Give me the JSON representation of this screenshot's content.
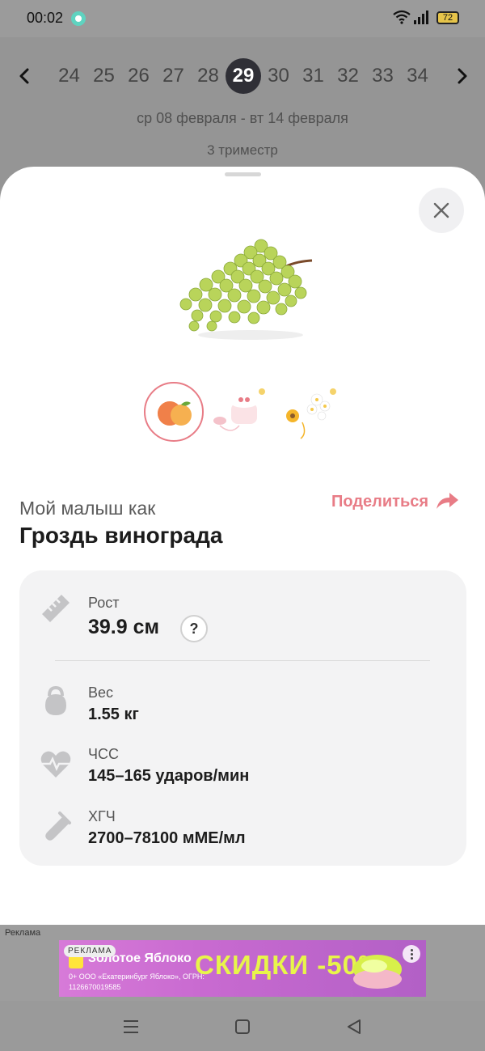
{
  "status_bar": {
    "time": "00:02",
    "battery": "72"
  },
  "week_nav": {
    "weeks": [
      "24",
      "25",
      "26",
      "27",
      "28",
      "29",
      "30",
      "31",
      "32",
      "33",
      "34"
    ],
    "selected": "29",
    "date_range": "ср 08 февраля - вт 14 февраля",
    "trimester": "3 триместр"
  },
  "size_compare": {
    "subtitle": "Мой малыш как",
    "title": "Гроздь винограда",
    "share_label": "Поделиться",
    "thumbnails": [
      "peach",
      "cake",
      "flowers"
    ],
    "selected_thumbnail": "peach"
  },
  "stats": {
    "height": {
      "label": "Рост",
      "value": "39.9 см",
      "help": "?"
    },
    "weight": {
      "label": "Вес",
      "value": "1.55 кг"
    },
    "heart_rate": {
      "label": "ЧСС",
      "value": "145–165 ударов/мин"
    },
    "hcg": {
      "label": "ХГЧ",
      "value": "2700–78100 мМЕ/мл"
    }
  },
  "ad": {
    "label": "Реклама",
    "badge": "РЕКЛАМА",
    "brand": "Золотое Яблоко",
    "legal": "0+ ООО «Екатеринбург Яблоко», ОГРН: 1126670019585",
    "headline": "СКИДКИ -50%"
  },
  "colors": {
    "accent": "#e87c86",
    "selected_week": "#2f2f36",
    "card_bg": "#f3f3f4",
    "ad_headline": "#e8f54a"
  },
  "icons": {
    "prev": "chevron-left-icon",
    "next": "chevron-right-icon",
    "close": "close-icon",
    "share": "share-arrow-icon",
    "height": "ruler-icon",
    "weight": "kettlebell-icon",
    "heart_rate": "heartbeat-icon",
    "hcg": "test-tube-icon"
  }
}
